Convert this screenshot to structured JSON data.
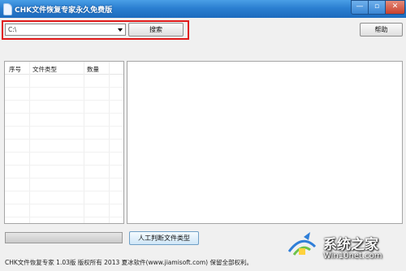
{
  "window": {
    "title": "CHK文件恢复专家永久免费版",
    "min_label": "—",
    "max_label": "▫",
    "close_label": "✕"
  },
  "toolbar": {
    "drive_value": "C:\\",
    "search_label": "搜索",
    "help_label": "帮助"
  },
  "file_table": {
    "columns": [
      "序号",
      "文件类型",
      "数量"
    ],
    "rows": []
  },
  "progress": {
    "value": 0
  },
  "actions": {
    "detect_type_label": "人工判断文件类型"
  },
  "footer": {
    "text": "CHK文件恢复专家 1.03版  版权所有 2013  夏冰软件(www.jiamisoft.com)  保留全部权利。"
  },
  "watermark": {
    "brand": "系统之家",
    "url": "Win10net.com"
  },
  "colors": {
    "title_bar": "#2b7fd1",
    "highlight": "#e01818",
    "client_bg": "#f0f0f0"
  },
  "icons": [
    "app-icon",
    "dropdown-arrow-icon",
    "watermark-logo-icon"
  ]
}
